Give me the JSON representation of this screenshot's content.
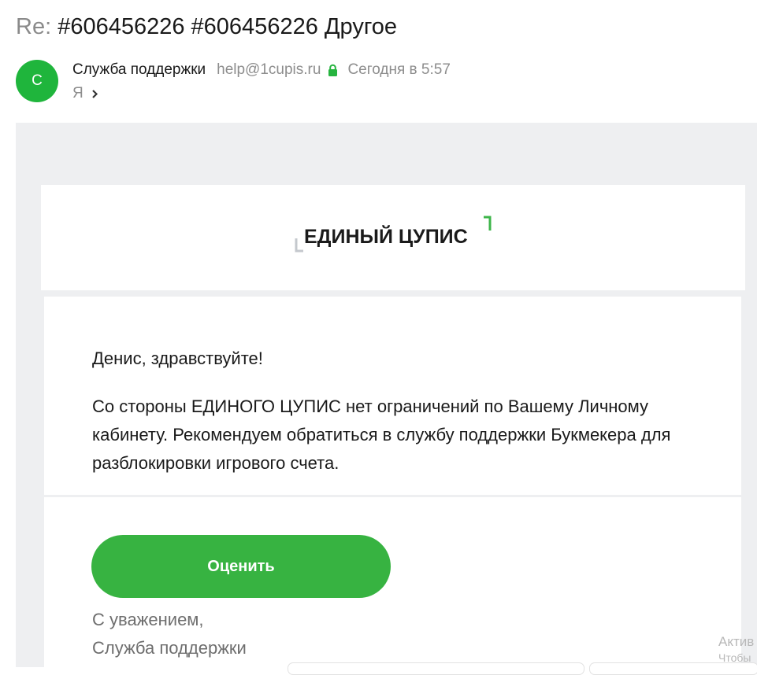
{
  "email": {
    "subject_prefix": "Re:",
    "subject": "#606456226 #606456226 Другое",
    "sender": {
      "avatar_letter": "С",
      "name": "Служба поддержки",
      "email": "help@1cupis.ru",
      "date": "Сегодня в 5:57"
    },
    "recipient": "Я"
  },
  "body": {
    "logo_text": "ЕДИНЫЙ ЦУПИС",
    "greeting": "Денис, здравствуйте!",
    "message": "Со стороны ЕДИНОГО ЦУПИС нет ограничений по Вашему Личному кабинету. Рекомендуем обратиться в службу поддержки Букмекера для разблокировки игрового счета.",
    "rate_button": "Оценить",
    "signature_line1": "С уважением,",
    "signature_line2": "Служба поддержки"
  },
  "overlay": {
    "watermark_line1": "Актив",
    "watermark_line2": "Чтобы"
  },
  "colors": {
    "brand_green": "#1fb53c",
    "button_green": "#37b341",
    "body_background": "#eeeff1"
  },
  "icons": {
    "lock": "lock-icon",
    "chevron": "chevron-right-icon"
  }
}
